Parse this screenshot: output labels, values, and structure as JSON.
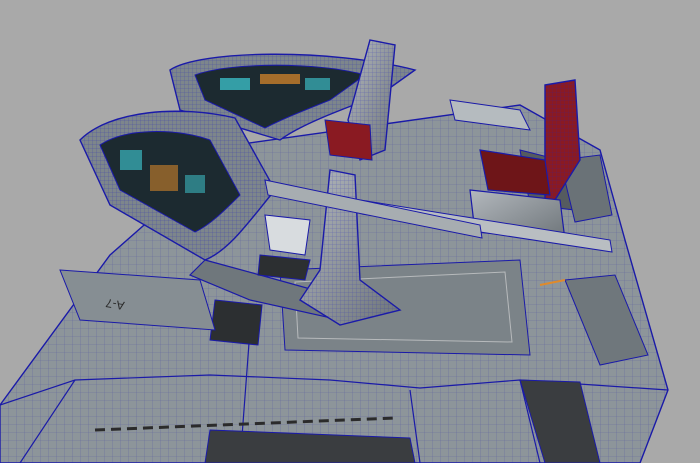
{
  "viewport": {
    "background_color": "#a9a9a9",
    "wire_color": "#1a1aa8",
    "panel_color": "#8f979c",
    "panel_dark": "#5c6368",
    "screen_cyan": "#3fd0d8",
    "screen_orange": "#e08a2a",
    "seat_red": "#8a1a22"
  },
  "decal": {
    "label": "A-7"
  }
}
